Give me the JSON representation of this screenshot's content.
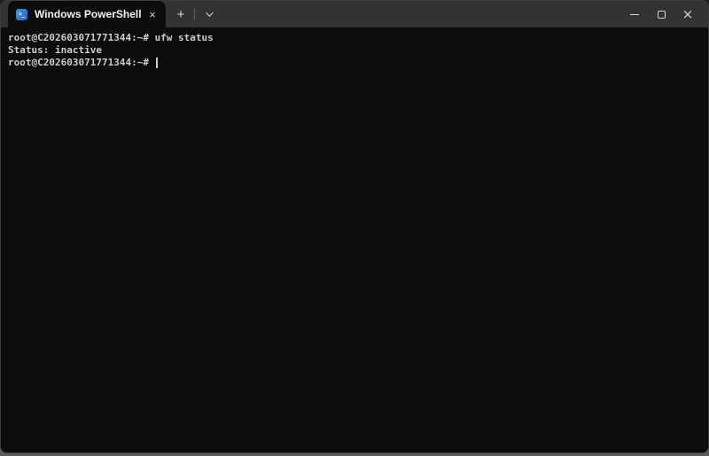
{
  "titlebar": {
    "tab": {
      "title": "Windows PowerShell",
      "powershell_glyph": ">_",
      "close_glyph": "×"
    },
    "new_tab_glyph": "+",
    "window_controls": {
      "minimize": "minimize",
      "maximize": "maximize",
      "close_glyph": "×"
    }
  },
  "terminal": {
    "lines": [
      {
        "text": "root@C202603071771344:~# ufw status"
      },
      {
        "text": "Status: inactive"
      },
      {
        "text": "root@C202603071771344:~# "
      }
    ],
    "prompt": "root@C202603071771344:~#",
    "last_command": "ufw status",
    "command_output": "Status: inactive",
    "cursor_visible": true
  },
  "icons": {
    "powershell": "blue square with white prompt arrow",
    "tab_close": "x-cross",
    "new_tab": "plus",
    "tab_dropdown": "chevron-down",
    "minimize": "horizontal-bar",
    "maximize": "square-outline",
    "window_close": "x-cross"
  },
  "colors": {
    "terminal_background": "#0c0c0c",
    "titlebar_background": "#333333",
    "tab_background": "#0c0c0c",
    "terminal_text": "#cccccc",
    "tab_title_text": "#f2f2f2",
    "powershell_blue": "#2e72c8"
  }
}
